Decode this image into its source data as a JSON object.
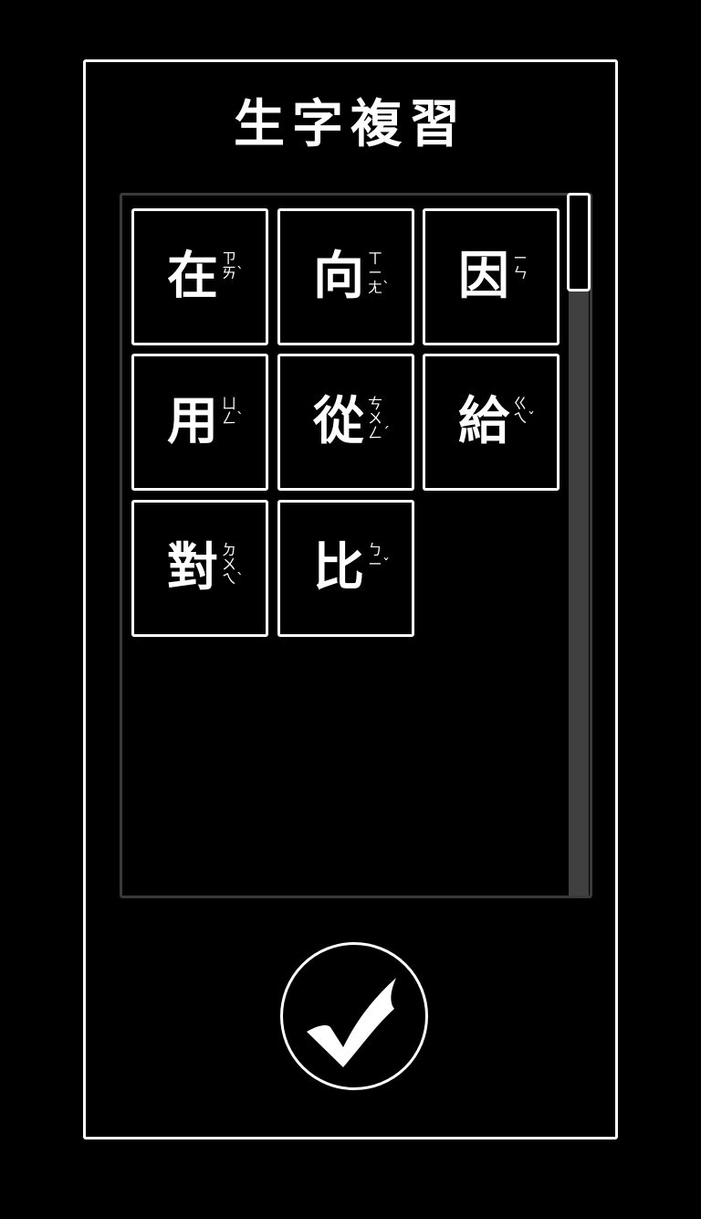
{
  "title": "生字複習",
  "characters": [
    {
      "char": "在",
      "zhuyin": "ㄗㄞˋ"
    },
    {
      "char": "向",
      "zhuyin": "ㄒㄧㄤˋ"
    },
    {
      "char": "因",
      "zhuyin": "ㄧㄣ"
    },
    {
      "char": "用",
      "zhuyin": "ㄩㄥˋ"
    },
    {
      "char": "從",
      "zhuyin": "ㄘㄨㄥˊ"
    },
    {
      "char": "給",
      "zhuyin": "ㄍㄟˇ"
    },
    {
      "char": "對",
      "zhuyin": "ㄉㄨㄟˋ"
    },
    {
      "char": "比",
      "zhuyin": "ㄅㄧˇ"
    }
  ],
  "confirm_icon": "checkmark-icon",
  "colors": {
    "background": "#000000",
    "foreground": "#ffffff",
    "scroll_track": "#404040",
    "list_border": "#3a3a3a"
  }
}
